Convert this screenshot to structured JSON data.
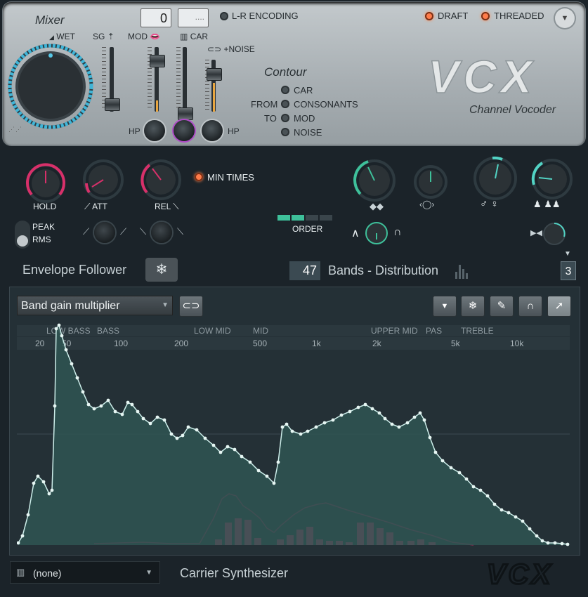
{
  "mixer": {
    "title": "Mixer",
    "wet_label": "WET",
    "sg_label": "SG",
    "mod_label": "MOD",
    "car_label": "CAR",
    "noise_label": "+NOISE",
    "hp_left": "HP",
    "hp_right": "HP",
    "value_box": "0",
    "value_box2": "...."
  },
  "header": {
    "lr_encoding": "L-R ENCODING",
    "draft": "DRAFT",
    "threaded": "THREADED",
    "logo_text": "VCX",
    "subtitle": "Channel Vocoder"
  },
  "contour": {
    "title": "Contour",
    "from": "FROM",
    "to": "TO",
    "options": [
      "CAR",
      "CONSONANTS",
      "MOD",
      "NOISE"
    ]
  },
  "envelope": {
    "hold": "HOLD",
    "att": "ATT",
    "rel": "REL",
    "min_times": "MIN TIMES",
    "peak": "PEAK",
    "rms": "RMS",
    "order": "ORDER",
    "title": "Envelope Follower"
  },
  "bands": {
    "count": "47",
    "label": "Bands - Distribution",
    "value": "3"
  },
  "graph": {
    "mode": "Band gain multiplier",
    "band_names": [
      "LOW BASS",
      "BASS",
      "LOW MID",
      "MID",
      "UPPER MID",
      "PAS",
      "TREBLE"
    ],
    "freq_ticks": [
      "20",
      "50",
      "100",
      "200",
      "500",
      "1k",
      "2k",
      "5k",
      "10k"
    ]
  },
  "footer": {
    "carrier_value": "(none)",
    "carrier_label": "Carrier Synthesizer",
    "logo_text": "VCX"
  },
  "colors": {
    "accent_teal": "#52d3c4",
    "accent_pink": "#d8306a",
    "led_orange": "#ff7c4a"
  }
}
